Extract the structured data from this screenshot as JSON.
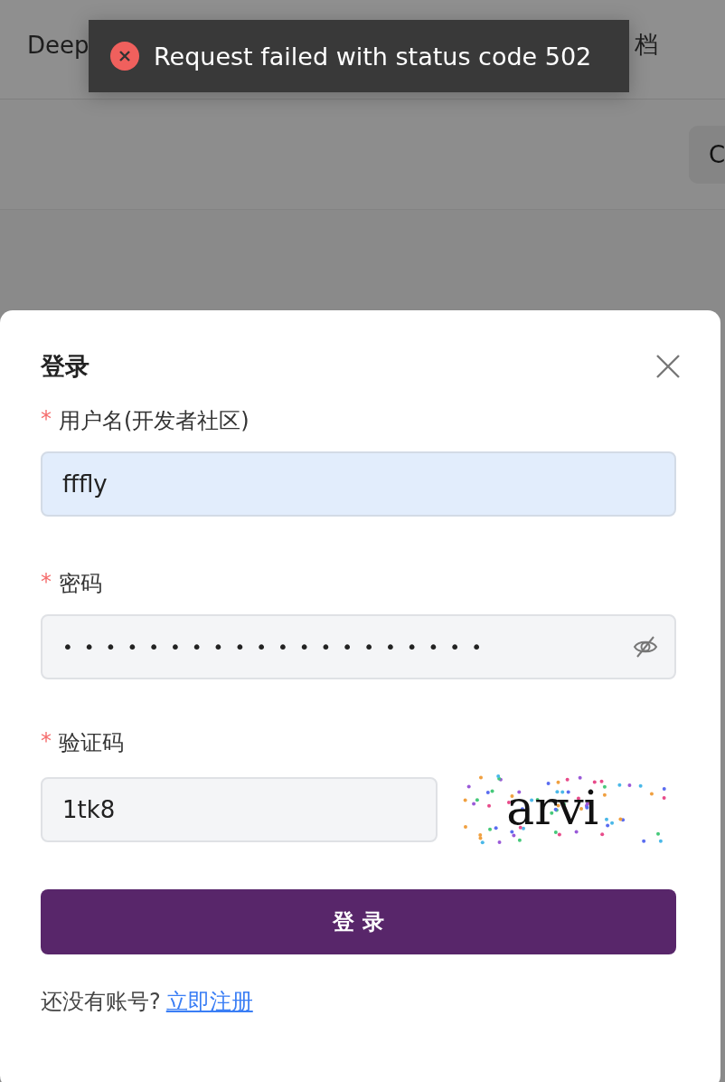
{
  "nav": {
    "items": [
      {
        "label": "Deep"
      },
      {
        "label": "档"
      }
    ]
  },
  "toolbar": {
    "button": "C"
  },
  "toast": {
    "kind": "error",
    "message": "Request failed with status code 502"
  },
  "login_dialog": {
    "title": "登录",
    "fields": [
      {
        "kind": "text",
        "label": "用户名(开发者社区)",
        "required_mark": "*",
        "value": "fffly",
        "autofilled": true
      },
      {
        "kind": "password",
        "label": "密码",
        "required_mark": "*",
        "value": "••••••••••••••••••••"
      },
      {
        "kind": "captcha",
        "label": "验证码",
        "required_mark": "*",
        "value": "1tk8",
        "captcha": "arvi"
      }
    ],
    "submit": "登 录",
    "footer": {
      "text": "还没有账号?",
      "link": "立即注册"
    }
  }
}
